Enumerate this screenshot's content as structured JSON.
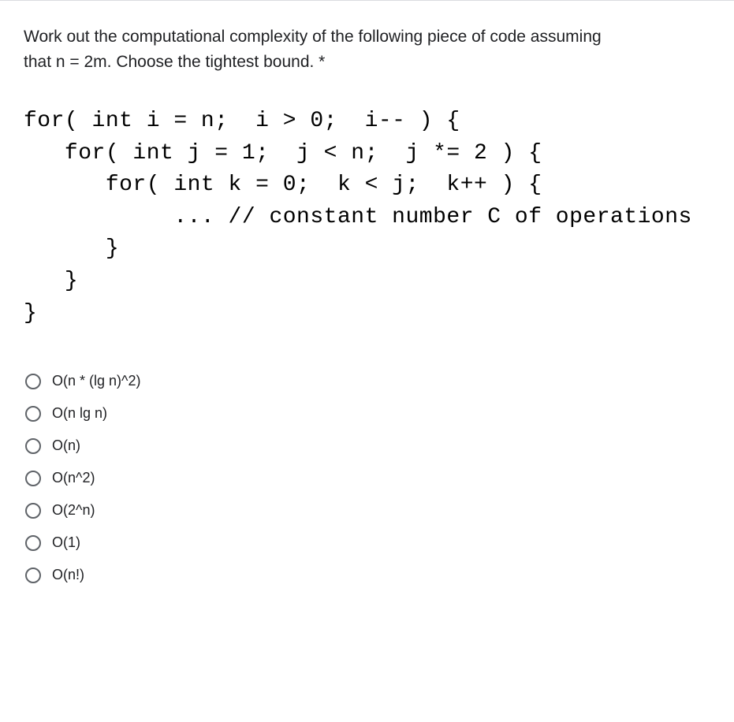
{
  "question": {
    "prompt_line1": "Work out the computational complexity of the following piece of code assuming",
    "prompt_line2": "that n = 2m. Choose the tightest bound.",
    "required_marker": " *"
  },
  "code": "for( int i = n;  i > 0;  i-- ) {\n   for( int j = 1;  j < n;  j *= 2 ) {\n      for( int k = 0;  k < j;  k++ ) {\n           ... // constant number C of operations\n      }\n   }\n}",
  "options": [
    {
      "label": "O(n * (lg n)^2)"
    },
    {
      "label": "O(n lg n)"
    },
    {
      "label": "O(n)"
    },
    {
      "label": "O(n^2)"
    },
    {
      "label": "O(2^n)"
    },
    {
      "label": "O(1)"
    },
    {
      "label": "O(n!)"
    }
  ]
}
